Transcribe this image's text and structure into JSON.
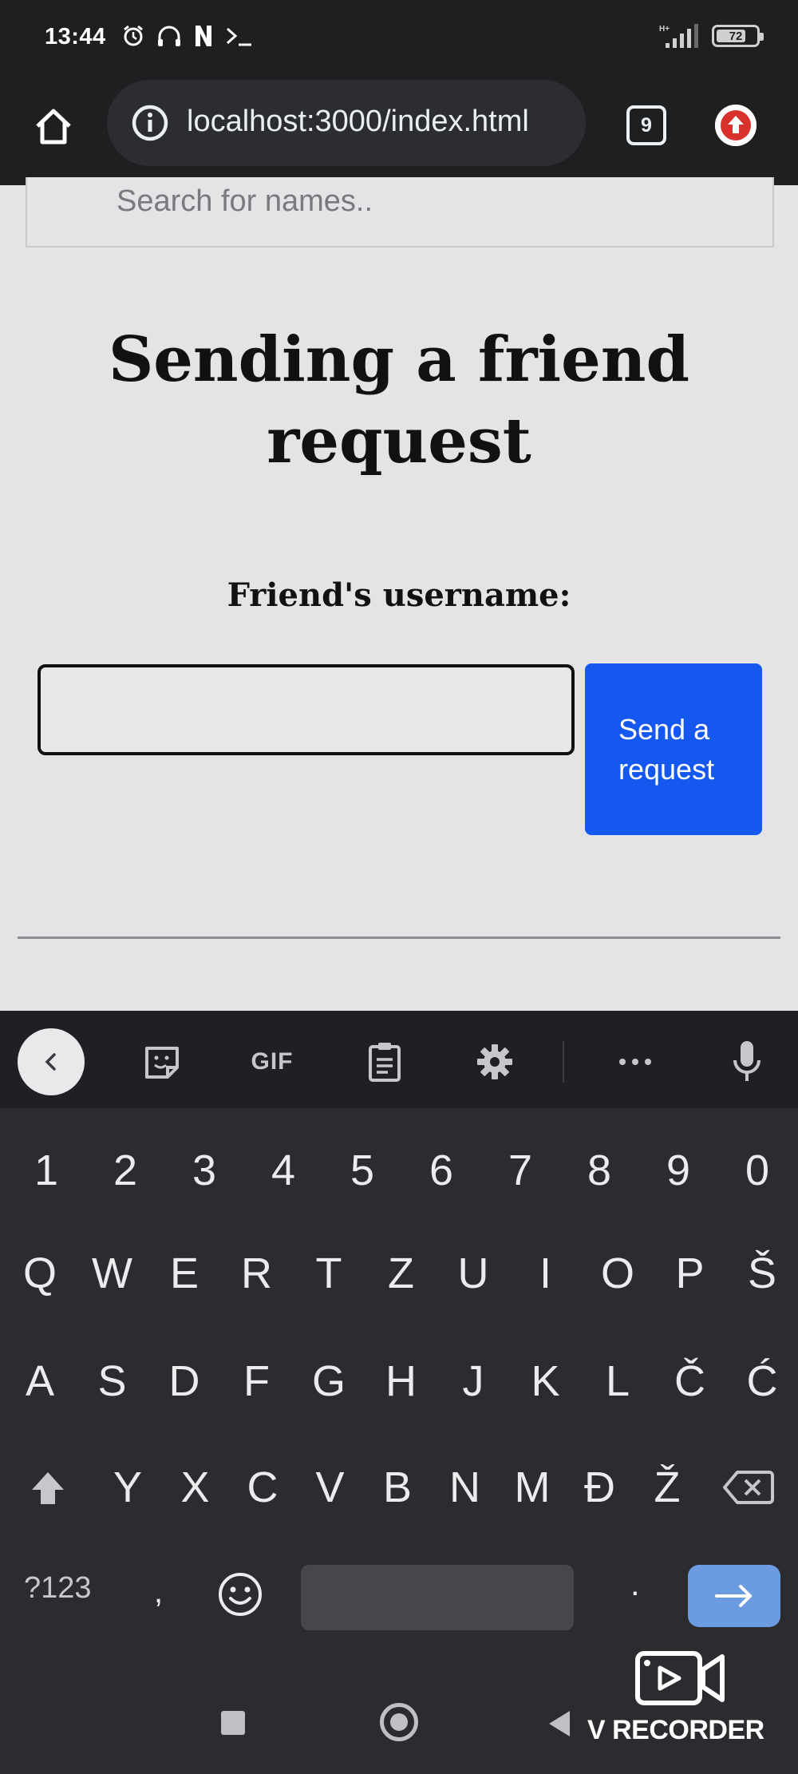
{
  "status_bar": {
    "time": "13:44",
    "battery": "72",
    "network": "H+"
  },
  "browser": {
    "url": "localhost:3000/index.html",
    "tab_count": "9"
  },
  "search": {
    "placeholder": "Search for names.."
  },
  "page": {
    "heading": "Sending a friend request",
    "field_label": "Friend's username:",
    "input_value": "",
    "send_button_label": "Send a request"
  },
  "keyboard": {
    "toolbar": {
      "gif_label": "GIF"
    },
    "rows": [
      [
        "1",
        "2",
        "3",
        "4",
        "5",
        "6",
        "7",
        "8",
        "9",
        "0"
      ],
      [
        "Q",
        "W",
        "E",
        "R",
        "T",
        "Z",
        "U",
        "I",
        "O",
        "P",
        "Š"
      ],
      [
        "A",
        "S",
        "D",
        "F",
        "G",
        "H",
        "J",
        "K",
        "L",
        "Č",
        "Ć"
      ],
      [
        "Y",
        "X",
        "C",
        "V",
        "B",
        "N",
        "M",
        "Đ",
        "Ž"
      ]
    ],
    "symbols_label": "?123",
    "comma_label": ",",
    "period_label": "."
  },
  "watermark": {
    "text": "V RECORDER"
  },
  "colors": {
    "accent": "#1558f0",
    "enter_key": "#6b9be0",
    "background": "#e4e4e6",
    "chrome": "#1e1f21"
  }
}
